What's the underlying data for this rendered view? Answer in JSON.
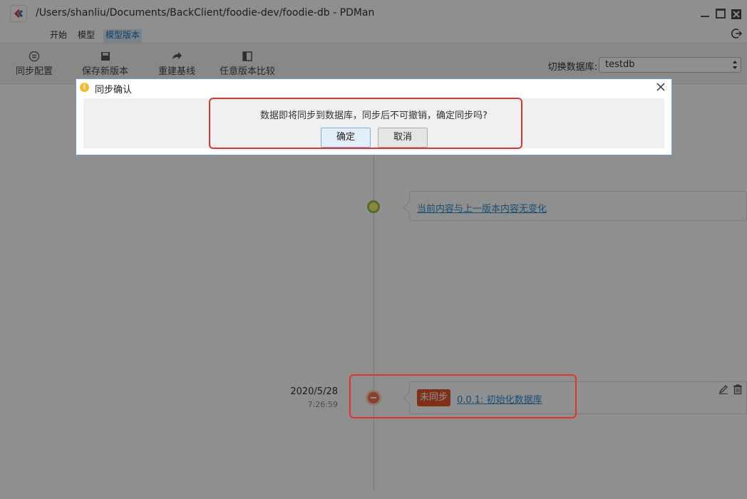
{
  "window": {
    "title": "/Users/shanliu/Documents/BackClient/foodie-dev/foodie-db - PDMan"
  },
  "menu": {
    "items": [
      {
        "label": "开始"
      },
      {
        "label": "模型"
      },
      {
        "label": "模型版本"
      }
    ],
    "active_index": 2
  },
  "toolbar": {
    "tools": [
      {
        "label": "同步配置",
        "icon": "sync-config-icon"
      },
      {
        "label": "保存新版本",
        "icon": "save-icon"
      },
      {
        "label": "重建基线",
        "icon": "rebuild-arrow-icon"
      },
      {
        "label": "任意版本比较",
        "icon": "compare-icon"
      }
    ],
    "db_label": "切换数据库:",
    "db_value": "testdb"
  },
  "timeline": {
    "current_entry": {
      "text": "当前内容与上一版本内容无变化"
    },
    "versions": [
      {
        "date": "2020/5/28",
        "time": "7:26:59",
        "status": "未同步",
        "label": "0.0.1: 初始化数据库"
      }
    ]
  },
  "dialog": {
    "title": "同步确认",
    "message": "数据即将同步到数据库，同步后不可撤销，确定同步吗?",
    "ok_label": "确定",
    "cancel_label": "取消"
  },
  "colors": {
    "accent": "#2b8ccf",
    "badge_unsynced": "#e4572e",
    "annotation": "#e2342f",
    "overlay": "rgba(0,0,0,0.44)"
  }
}
